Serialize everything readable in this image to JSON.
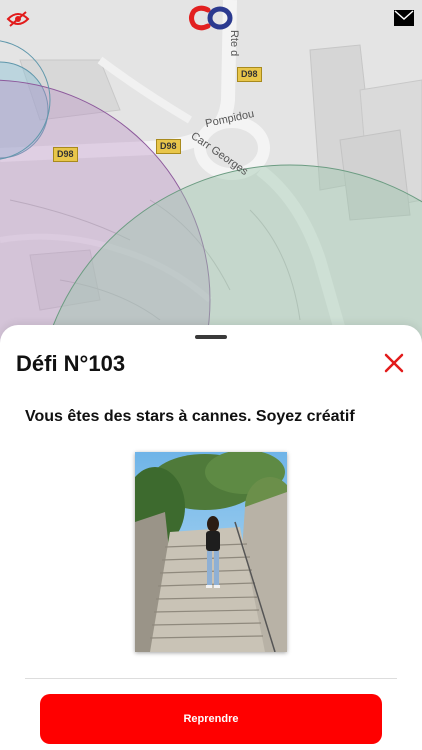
{
  "map": {
    "road_labels": [
      "D98",
      "D98",
      "D98"
    ],
    "street_names": [
      "Rte d",
      "Pompidou",
      "Carr Georges"
    ]
  },
  "header": {
    "left_icon": "eye-slash-icon",
    "logo": "app-logo",
    "right_icon": "mail-icon"
  },
  "sheet": {
    "title": "Défi N°103",
    "close_icon": "close-icon",
    "challenge": "Vous êtes des stars à cannes. Soyez créatif",
    "photo": "challenge-photo",
    "button_label": "Reprendre"
  },
  "colors": {
    "accent": "#ff0000",
    "zone_blue": "#8cc3d6",
    "zone_green": "#9fc7b0",
    "zone_purple": "#b889c4"
  }
}
